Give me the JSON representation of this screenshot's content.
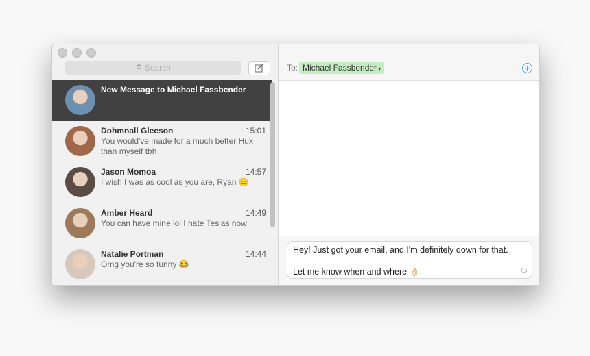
{
  "sidebar": {
    "search_placeholder": "Search",
    "conversations": [
      {
        "name": "New Message to Michael Fassbender",
        "time": "",
        "preview": "",
        "selected": true,
        "avatar": "#6d8fb0"
      },
      {
        "name": "Dohmnall Gleeson",
        "time": "15:01",
        "preview": "You would've made for a much better Hux than myself tbh",
        "avatar": "#a0674a"
      },
      {
        "name": "Jason Momoa",
        "time": "14:57",
        "preview": "I wish I was as cool as you are, Ryan 😑",
        "avatar": "#5a4c44"
      },
      {
        "name": "Amber Heard",
        "time": "14:49",
        "preview": "You can have mine lol I hate Teslas now",
        "avatar": "#9c7a5a"
      },
      {
        "name": "Natalie Portman",
        "time": "14:44",
        "preview": "Omg you're so funny 😂",
        "avatar": "#d8c8bc"
      }
    ]
  },
  "header": {
    "to_label": "To:",
    "recipient": "Michael Fassbender"
  },
  "composer": {
    "line1": "Hey! Just got your email, and I'm definitely down for that.",
    "line2": "Let me know when and where 👌🏻"
  }
}
